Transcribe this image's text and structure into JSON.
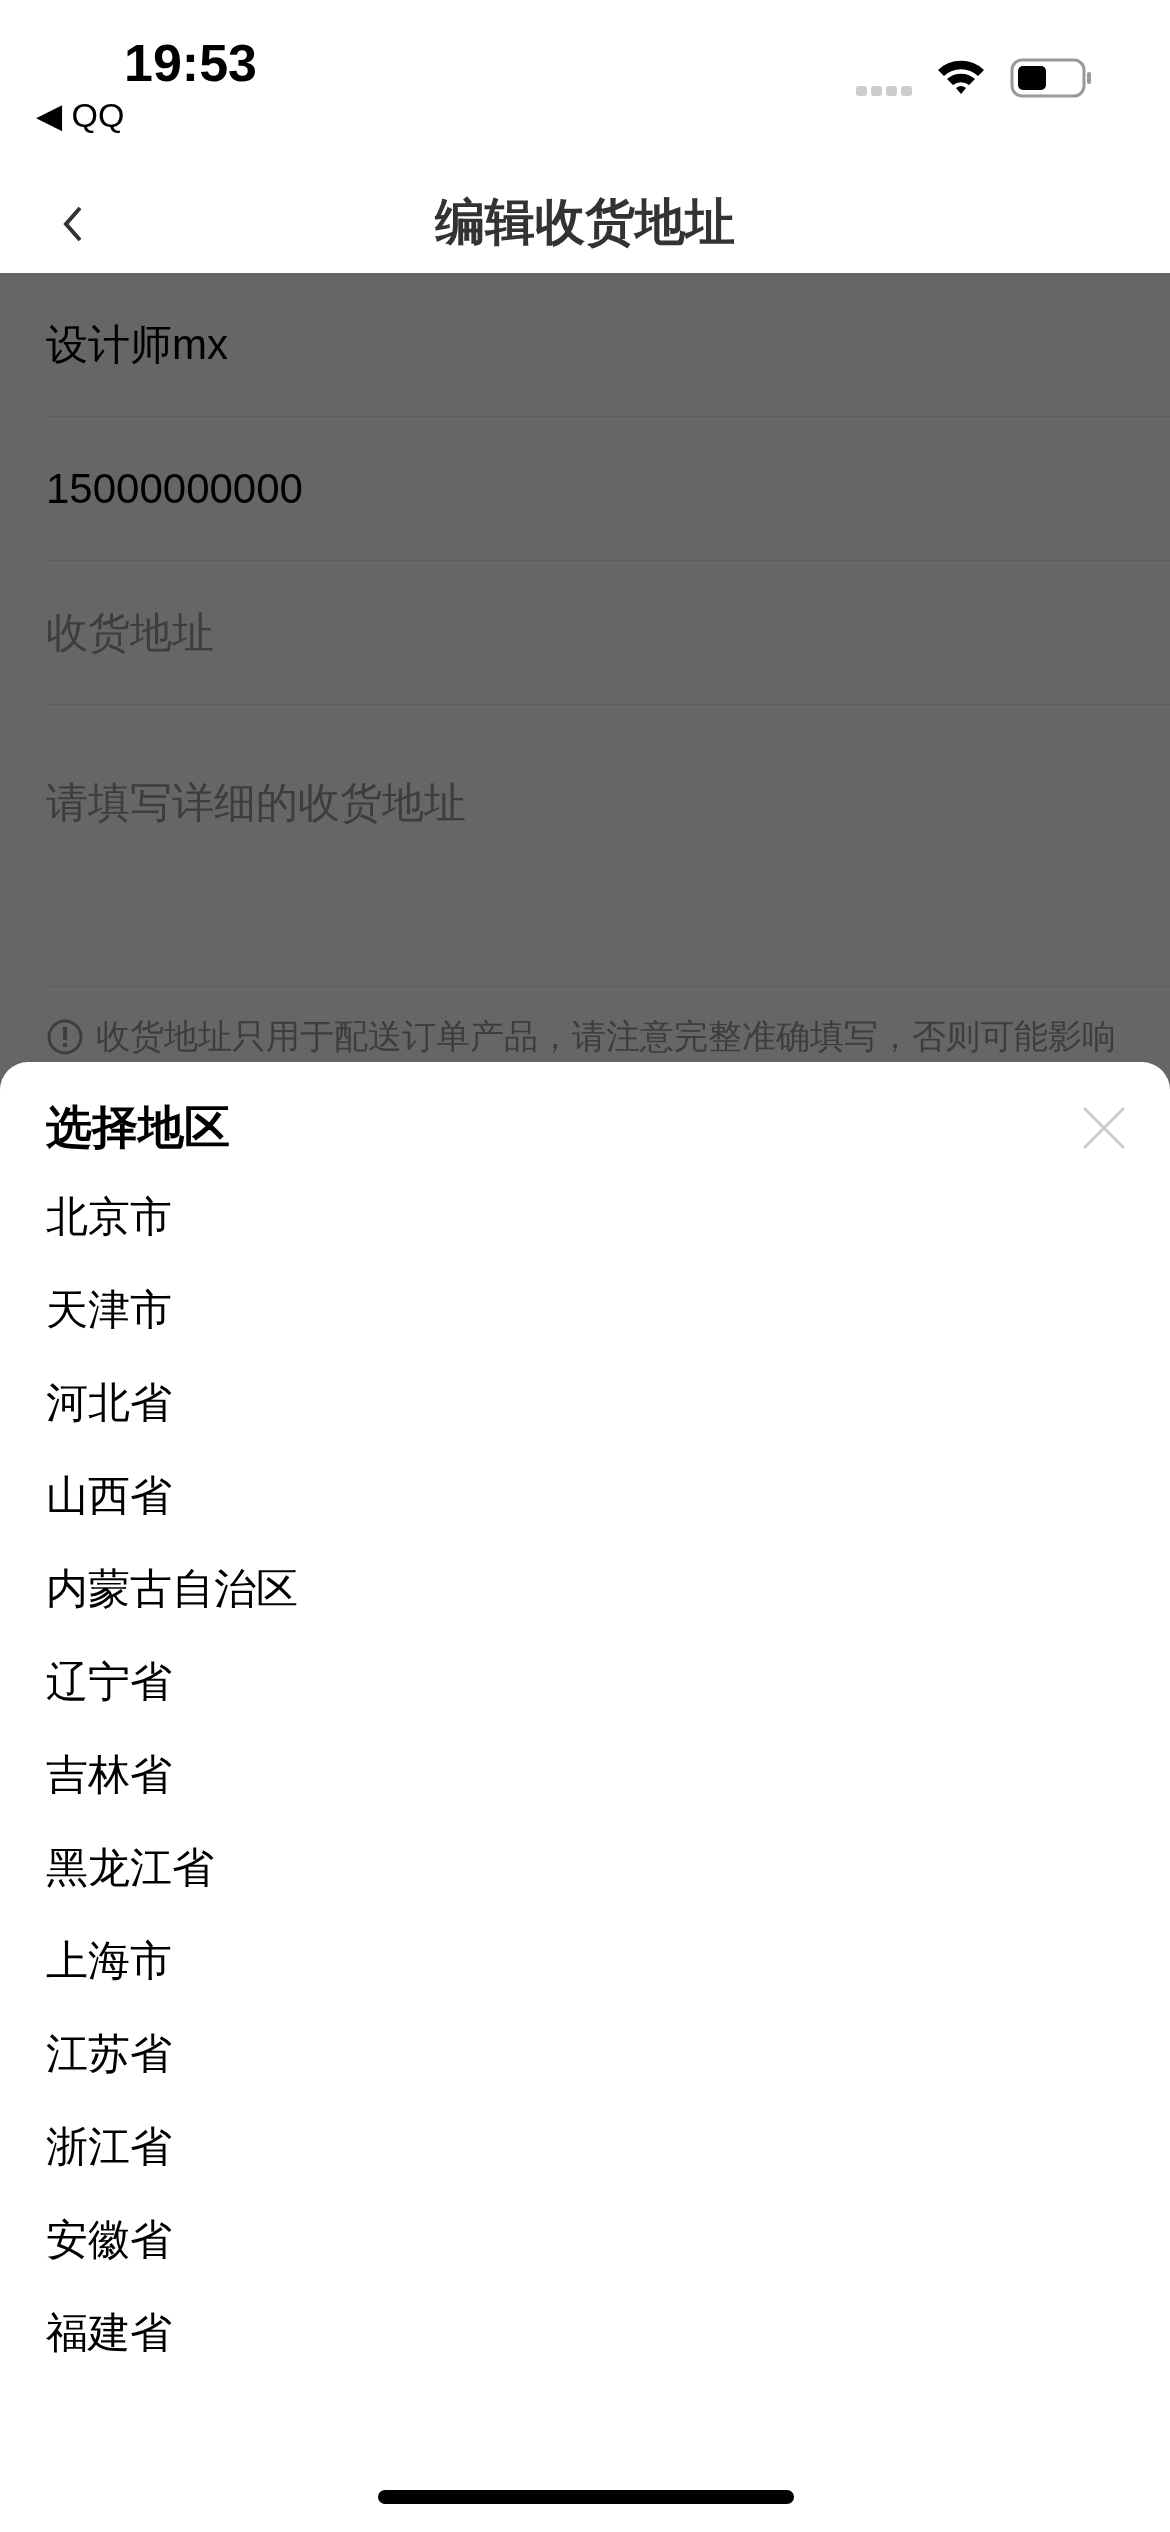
{
  "status_bar": {
    "time": "19:53",
    "back_app": "◀ QQ"
  },
  "nav_bar": {
    "title": "编辑收货地址"
  },
  "form": {
    "fields": [
      {
        "kind": "value",
        "text": "设计师mx"
      },
      {
        "kind": "value",
        "text": "15000000000"
      },
      {
        "kind": "placeholder",
        "text": "收货地址"
      },
      {
        "kind": "textarea",
        "text": "请填写详细的收货地址"
      }
    ],
    "notice": "收货地址只用于配送订单产品，请注意完整准确填写，否则可能影响"
  },
  "region_sheet": {
    "title": "选择地区",
    "items": [
      "北京市",
      "天津市",
      "河北省",
      "山西省",
      "内蒙古自治区",
      "辽宁省",
      "吉林省",
      "黑龙江省",
      "上海市",
      "江苏省",
      "浙江省",
      "安徽省",
      "福建省"
    ]
  }
}
